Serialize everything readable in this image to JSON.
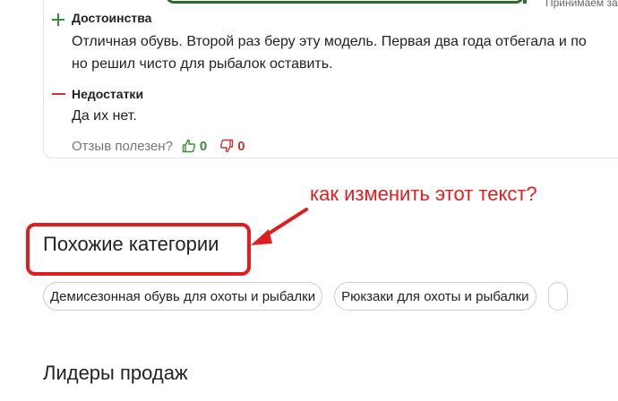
{
  "header": {
    "right_text": "Принимаем за"
  },
  "review": {
    "pros_label": "Достоинства",
    "pros_lines": [
      "Отличная обувь. Второй раз беру эту модель. Первая два года отбегала и по",
      "но решил чисто для рыбалок оставить."
    ],
    "cons_label": "Недостатки",
    "cons_text": "Да их нет.",
    "helpful_label": "Отзыв полезен?",
    "likes": "0",
    "dislikes": "0"
  },
  "annotation": {
    "question": "как изменить этот текст?",
    "color": "#e01e1e"
  },
  "similar": {
    "title": "Похожие категории",
    "chips": [
      "Демисезонная обувь для охоты и рыбалки",
      "Рюкзаки для охоты и рыбалки"
    ]
  },
  "leaders": {
    "title": "Лидеры продаж"
  },
  "colors": {
    "accent_green": "#3c8a3c",
    "accent_red": "#c0392b",
    "header_green": "#2f6b2f"
  }
}
